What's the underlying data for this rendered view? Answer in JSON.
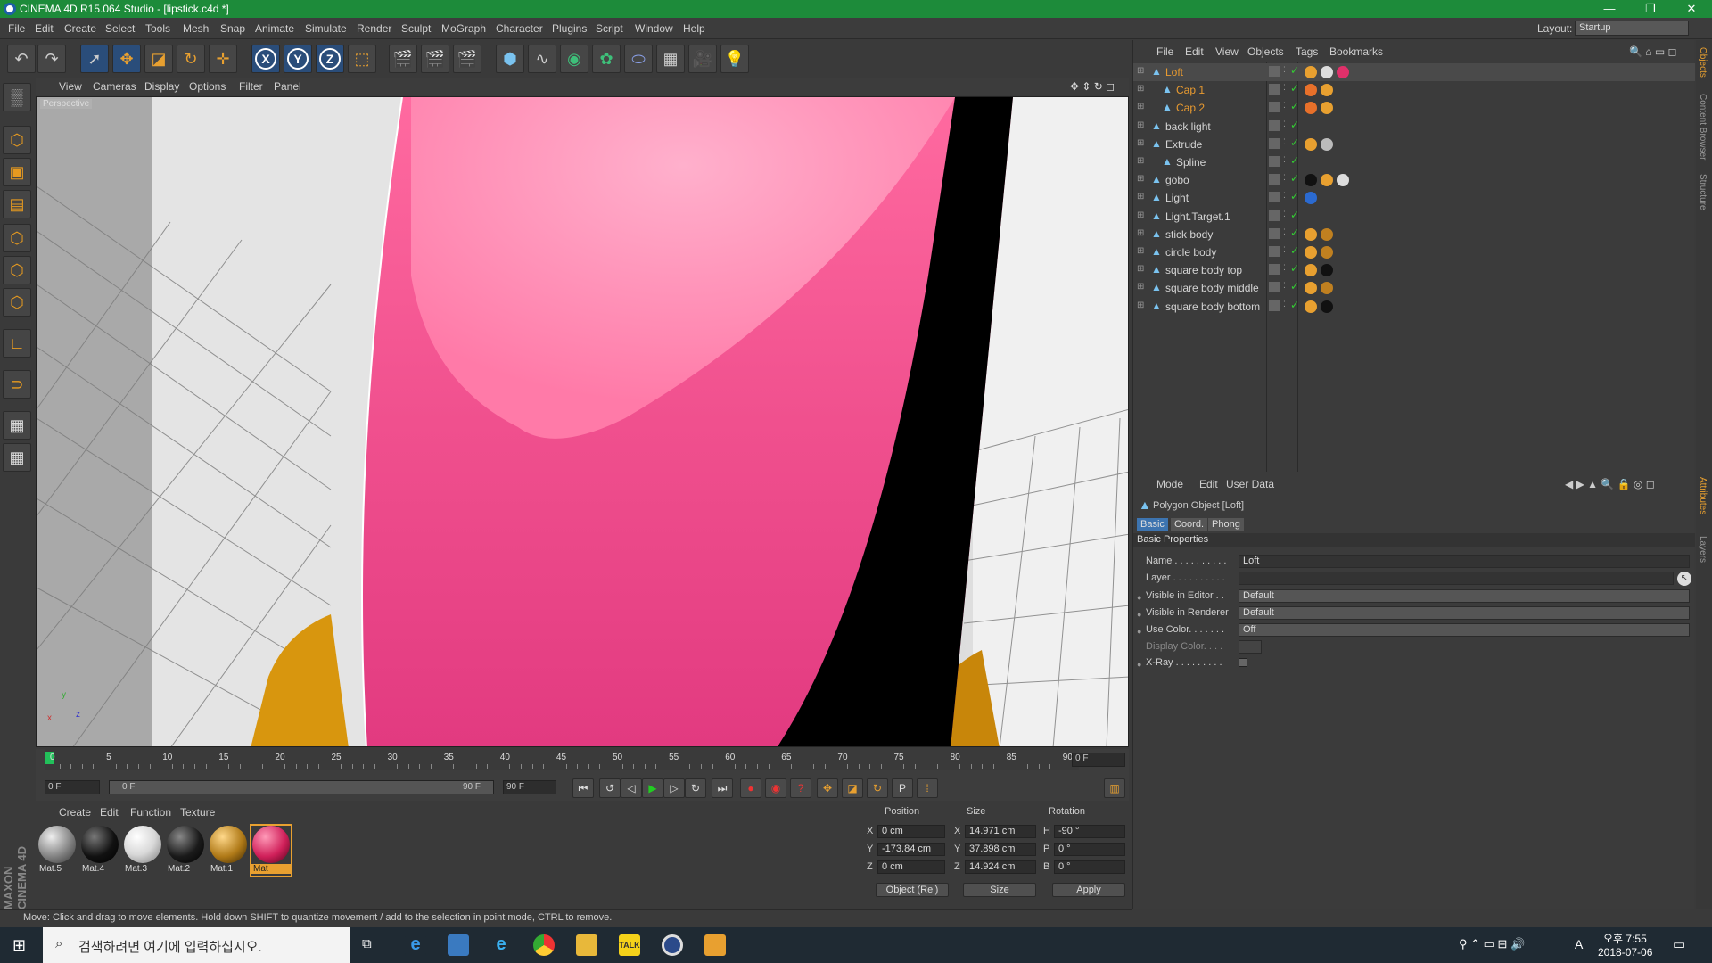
{
  "window": {
    "title": "CINEMA 4D R15.064 Studio - [lipstick.c4d *]",
    "controls": [
      "—",
      "❐",
      "✕"
    ]
  },
  "menu": [
    "File",
    "Edit",
    "Create",
    "Select",
    "Tools",
    "Mesh",
    "Snap",
    "Animate",
    "Simulate",
    "Render",
    "Sculpt",
    "MoGraph",
    "Character",
    "Plugins",
    "Script",
    "Window",
    "Help"
  ],
  "layout": {
    "label": "Layout:",
    "value": "Startup"
  },
  "viewport": {
    "menu": [
      "View",
      "Cameras",
      "Display",
      "Options",
      "Filter",
      "Panel"
    ],
    "label": "Perspective",
    "axes": {
      "x": "x",
      "y": "y",
      "z": "z"
    }
  },
  "timeline": {
    "ticks": [
      "0",
      "5",
      "10",
      "15",
      "20",
      "25",
      "30",
      "35",
      "40",
      "45",
      "50",
      "55",
      "60",
      "65",
      "70",
      "75",
      "80",
      "85",
      "90"
    ],
    "end_frame": "0 F",
    "start_field": "0 F",
    "range_start": "0 F",
    "range_end": "90 F",
    "max_field": "90 F"
  },
  "materials": {
    "menu": [
      "Create",
      "Edit",
      "Function",
      "Texture"
    ],
    "items": [
      {
        "name": "Mat.5",
        "color": "#7a7a7a"
      },
      {
        "name": "Mat.4",
        "color": "#111111"
      },
      {
        "name": "Mat.3",
        "color": "#d8d8d8"
      },
      {
        "name": "Mat.2",
        "color": "#1a1a1a"
      },
      {
        "name": "Mat.1",
        "color": "#b07a18"
      },
      {
        "name": "Mat",
        "color": "#d0205a"
      }
    ]
  },
  "coords": {
    "headers": [
      "Position",
      "Size",
      "Rotation"
    ],
    "rows": [
      {
        "p_label": "X",
        "p": "0 cm",
        "s_label": "X",
        "s": "14.971 cm",
        "r_label": "H",
        "r": "-90 °"
      },
      {
        "p_label": "Y",
        "p": "-173.84 cm",
        "s_label": "Y",
        "s": "37.898 cm",
        "r_label": "P",
        "r": "0 °"
      },
      {
        "p_label": "Z",
        "p": "0 cm",
        "s_label": "Z",
        "s": "14.924 cm",
        "r_label": "B",
        "r": "0 °"
      }
    ],
    "mode": "Object (Rel)",
    "size_mode": "Size",
    "apply": "Apply"
  },
  "status": "Move: Click and drag to move elements. Hold down SHIFT to quantize movement / add to the selection in point mode, CTRL to remove.",
  "objects": {
    "menu": [
      "File",
      "Edit",
      "View",
      "Objects",
      "Tags",
      "Bookmarks"
    ],
    "items": [
      {
        "name": "Loft",
        "color": "#e89a30",
        "indent": 0
      },
      {
        "name": "Cap 1",
        "color": "#e89a30",
        "indent": 1
      },
      {
        "name": "Cap 2",
        "color": "#e89a30",
        "indent": 1
      },
      {
        "name": "back light",
        "color": "#d4d4d4",
        "indent": 0
      },
      {
        "name": "Extrude",
        "color": "#d4d4d4",
        "indent": 0
      },
      {
        "name": "Spline",
        "color": "#d4d4d4",
        "indent": 1
      },
      {
        "name": "gobo",
        "color": "#d4d4d4",
        "indent": 0
      },
      {
        "name": "Light",
        "color": "#d4d4d4",
        "indent": 0
      },
      {
        "name": "Light.Target.1",
        "color": "#d4d4d4",
        "indent": 0
      },
      {
        "name": "stick body",
        "color": "#d4d4d4",
        "indent": 0
      },
      {
        "name": "circle body",
        "color": "#d4d4d4",
        "indent": 0
      },
      {
        "name": "square body top",
        "color": "#d4d4d4",
        "indent": 0
      },
      {
        "name": "square body middle",
        "color": "#d4d4d4",
        "indent": 0
      },
      {
        "name": "square body bottom",
        "color": "#d4d4d4",
        "indent": 0
      }
    ]
  },
  "attributes": {
    "menu": [
      "Mode",
      "Edit",
      "User Data"
    ],
    "object": "Polygon Object [Loft]",
    "tabs": [
      "Basic",
      "Coord.",
      "Phong"
    ],
    "section": "Basic Properties",
    "fields": [
      {
        "label": "Name . . . . . . . . . .",
        "value": "Loft"
      },
      {
        "label": "Layer . . . . . . . . . .",
        "value": ""
      },
      {
        "label": "Visible in Editor . .",
        "value": "Default"
      },
      {
        "label": "Visible in Renderer",
        "value": "Default"
      },
      {
        "label": "Use Color. . . . . . .",
        "value": "Off"
      },
      {
        "label": "Display Color. . . .",
        "value": ""
      },
      {
        "label": "X-Ray . . . . . . . . .",
        "value": ""
      }
    ]
  },
  "right_tabs": [
    "Objects",
    "Content Browser",
    "Structure"
  ],
  "right_tabs2": [
    "Attributes",
    "Layers"
  ],
  "taskbar": {
    "search": "검색하려면 여기에 입력하십시오.",
    "time": "오후 7:55",
    "date": "2018-07-06",
    "ime": "A"
  }
}
